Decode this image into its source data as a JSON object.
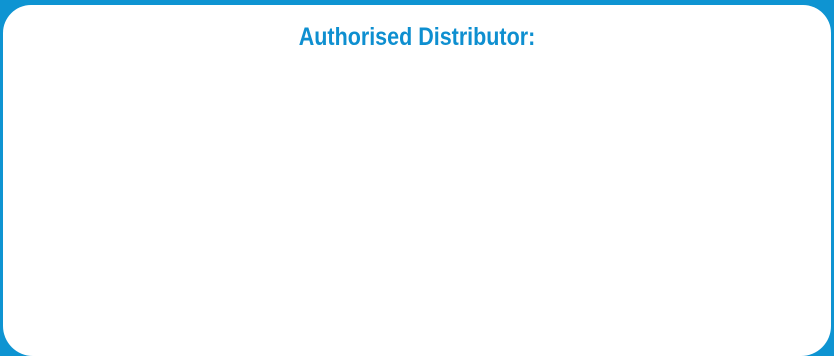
{
  "panel": {
    "heading": "Authorised Distributor:"
  },
  "colors": {
    "background": "#0e94d2",
    "panel": "#ffffff",
    "heading": "#0e8fd0"
  }
}
